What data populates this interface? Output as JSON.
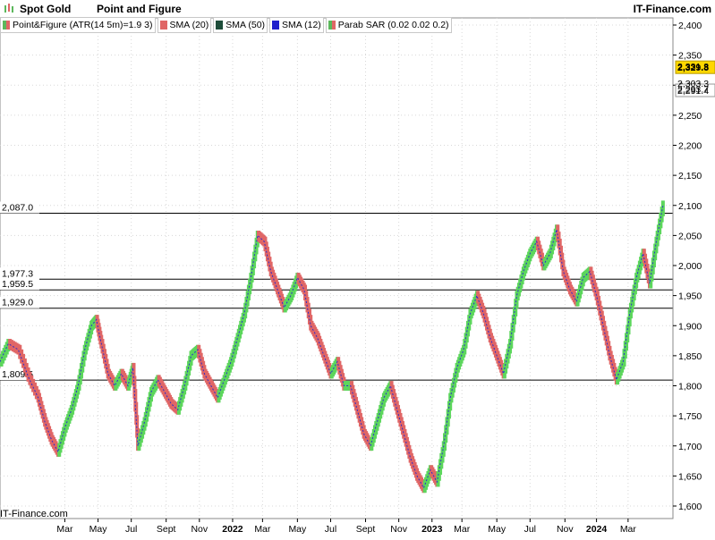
{
  "header": {
    "symbol": "Spot Gold",
    "chart_type": "Point and Figure",
    "brand": "IT-Finance.com",
    "watermark": "IT-Finance.com"
  },
  "legend": [
    {
      "label": "Point&Figure (ATR(14 5m)=1.9 3)",
      "color": "#e06666",
      "color2": "#5cb85c"
    },
    {
      "label": "SMA (20)",
      "color": "#e06666"
    },
    {
      "label": "SMA (50)",
      "color": "#1e4d3a"
    },
    {
      "label": "SMA (12)",
      "color": "#1f1fcc"
    },
    {
      "label": "Parab SAR (0.02 0.02 0.2)",
      "color": "#e06666",
      "color2": "#5cb85c"
    }
  ],
  "colors": {
    "up": "#5cd65c",
    "down": "#e06666",
    "sma": "#2b2bcc",
    "hline": "#000000",
    "current": "#ffd700"
  },
  "chart_data": {
    "type": "line",
    "title": "Spot Gold",
    "ylim": [
      1600,
      2410
    ],
    "yticks": [
      1600,
      1650,
      1700,
      1750,
      1800,
      1850,
      1900,
      1950,
      2000,
      2050,
      2100,
      2150,
      2200,
      2250,
      2300,
      2350,
      2400
    ],
    "ytick_labels": [
      "1,600",
      "1,650",
      "1,700",
      "1,750",
      "1,800",
      "1,850",
      "1,900",
      "1,950",
      "2,000",
      "2,050",
      "2,100",
      "2,150",
      "2,200",
      "2,250",
      "2,300",
      "2,350",
      "2,400"
    ],
    "x_labels": [
      {
        "label": "Mar",
        "bold": false
      },
      {
        "label": "May",
        "bold": false
      },
      {
        "label": "Jul",
        "bold": false
      },
      {
        "label": "Sept",
        "bold": false
      },
      {
        "label": "Nov",
        "bold": false
      },
      {
        "label": "2022",
        "bold": true
      },
      {
        "label": "Mar",
        "bold": false
      },
      {
        "label": "May",
        "bold": false
      },
      {
        "label": "Jul",
        "bold": false
      },
      {
        "label": "Sept",
        "bold": false
      },
      {
        "label": "Nov",
        "bold": false
      },
      {
        "label": "2023",
        "bold": true
      },
      {
        "label": "Mar",
        "bold": false
      },
      {
        "label": "May",
        "bold": false
      },
      {
        "label": "Jul",
        "bold": false
      },
      {
        "label": "Nov",
        "bold": false
      },
      {
        "label": "2024",
        "bold": true
      },
      {
        "label": "Mar",
        "bold": false
      }
    ],
    "x_positions": [
      0.4,
      2.4,
      4.4,
      6.5,
      8.5,
      10.5,
      12.3,
      14.4,
      16.4,
      18.5,
      20.5,
      22.5,
      24.3,
      26.4,
      28.4,
      30.5,
      32.4,
      34.3
    ],
    "xlim": [
      -3.5,
      37.0
    ],
    "hlines": [
      {
        "value": 2087.0,
        "label": "2,087.0"
      },
      {
        "value": 1977.3,
        "label": "1,977.3"
      },
      {
        "value": 1959.5,
        "label": "1,959.5"
      },
      {
        "value": 1929.0,
        "label": "1,929.0"
      },
      {
        "value": 1809.5,
        "label": "1,809.5"
      }
    ],
    "right_labels": [
      {
        "value": 2329.8,
        "label": "2,329.8",
        "style": "current"
      },
      {
        "value": 2291.4,
        "label": "2,291.4",
        "style": "plain"
      },
      {
        "value": 2331.3,
        "label": "2,331.3",
        "style": "faded"
      },
      {
        "value": 2303.3,
        "label": "2,303.3",
        "style": "faded"
      },
      {
        "value": 2293.7,
        "label": "2,293.7",
        "style": "faded"
      }
    ],
    "series": [
      {
        "x": [
          -3.5,
          -3.0,
          -2.4,
          -1.8,
          -1.2,
          -0.8,
          -0.4,
          0.0,
          0.4,
          0.8,
          1.2,
          1.6,
          2.0,
          2.3,
          2.6,
          3.0,
          3.4,
          3.8,
          4.2,
          4.5,
          4.8,
          5.2,
          5.6,
          6.0,
          6.4,
          6.8,
          7.2,
          7.6,
          8.0,
          8.4,
          8.8,
          9.2,
          9.6,
          10.0,
          10.4,
          10.8,
          11.2,
          11.6,
          12.0,
          12.4,
          12.8,
          13.2,
          13.6,
          14.0,
          14.4,
          14.8,
          15.2,
          15.6,
          16.0,
          16.4,
          16.8,
          17.2,
          17.6,
          18.0,
          18.4,
          18.8,
          19.2,
          19.6,
          20.0,
          20.4,
          20.8,
          21.2,
          21.6,
          22.0,
          22.4,
          22.8,
          23.2,
          23.6,
          24.0,
          24.4,
          24.8,
          25.2,
          25.6,
          26.0,
          26.4,
          26.8,
          27.2,
          27.6,
          28.0,
          28.4,
          28.8,
          29.2,
          29.6,
          30.0,
          30.4,
          30.8,
          31.2,
          31.6,
          32.0,
          32.4,
          32.8,
          33.2,
          33.6,
          34.0,
          34.4,
          34.8,
          35.2,
          35.6,
          36.0,
          36.4
        ],
        "values": [
          1840,
          1870,
          1860,
          1815,
          1780,
          1740,
          1710,
          1690,
          1730,
          1760,
          1800,
          1860,
          1900,
          1910,
          1870,
          1820,
          1800,
          1820,
          1800,
          1830,
          1700,
          1740,
          1790,
          1810,
          1790,
          1770,
          1760,
          1800,
          1850,
          1860,
          1820,
          1800,
          1780,
          1810,
          1840,
          1880,
          1920,
          1980,
          2050,
          2040,
          1990,
          1960,
          1930,
          1950,
          1980,
          1960,
          1900,
          1880,
          1850,
          1820,
          1840,
          1800,
          1800,
          1760,
          1720,
          1700,
          1740,
          1780,
          1800,
          1760,
          1720,
          1680,
          1650,
          1630,
          1660,
          1640,
          1700,
          1780,
          1830,
          1860,
          1920,
          1950,
          1920,
          1880,
          1850,
          1820,
          1870,
          1950,
          1990,
          2020,
          2040,
          2000,
          2020,
          2060,
          1990,
          1960,
          1940,
          1980,
          1990,
          1950,
          1900,
          1850,
          1810,
          1840,
          1920,
          1980,
          2020,
          1970,
          2040,
          2100
        ],
        "name": ""
      }
    ]
  }
}
